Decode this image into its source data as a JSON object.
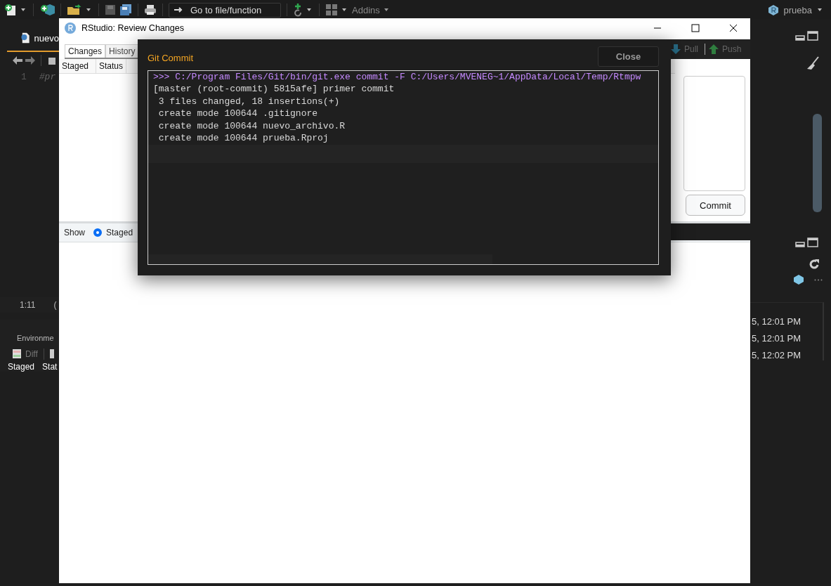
{
  "toolbar": {
    "goto_placeholder": "Go to file/function",
    "addins": "Addins",
    "project": "prueba"
  },
  "editor": {
    "tab": "nuevo",
    "line_number": "1",
    "code": "#pr",
    "position": "1:11",
    "file_type": "("
  },
  "env_pane": {
    "tab": "Environme",
    "diff": "Diff",
    "columns": [
      "Staged",
      "Stat"
    ]
  },
  "history_pane": {
    "times": [
      "5, 12:01 PM",
      "5, 12:01 PM",
      "5, 12:02 PM"
    ]
  },
  "review_window": {
    "title": "RStudio: Review Changes",
    "tabs": [
      {
        "label": "Changes",
        "selected": true
      },
      {
        "label": "History",
        "selected": false
      }
    ],
    "pull": "Pull",
    "push": "Push",
    "columns": [
      "Staged",
      "Status"
    ],
    "commit_button": "Commit",
    "show_label": "Show",
    "show_option": {
      "label": "Staged",
      "selected": true
    }
  },
  "git_commit_dialog": {
    "title": "Git Commit",
    "close": "Close",
    "output": [
      {
        "kind": "command",
        "text": ">>> C:/Program Files/Git/bin/git.exe commit -F C:/Users/MVENEG~1/AppData/Local/Temp/Rtmpw"
      },
      {
        "kind": "output",
        "text": "[master (root-commit) 5815afe] primer commit"
      },
      {
        "kind": "output",
        "text": " 3 files changed, 18 insertions(+)"
      },
      {
        "kind": "output",
        "text": " create mode 100644 .gitignore"
      },
      {
        "kind": "output",
        "text": " create mode 100644 nuevo_archivo.R"
      },
      {
        "kind": "output",
        "text": " create mode 100644 prueba.Rproj"
      }
    ]
  }
}
